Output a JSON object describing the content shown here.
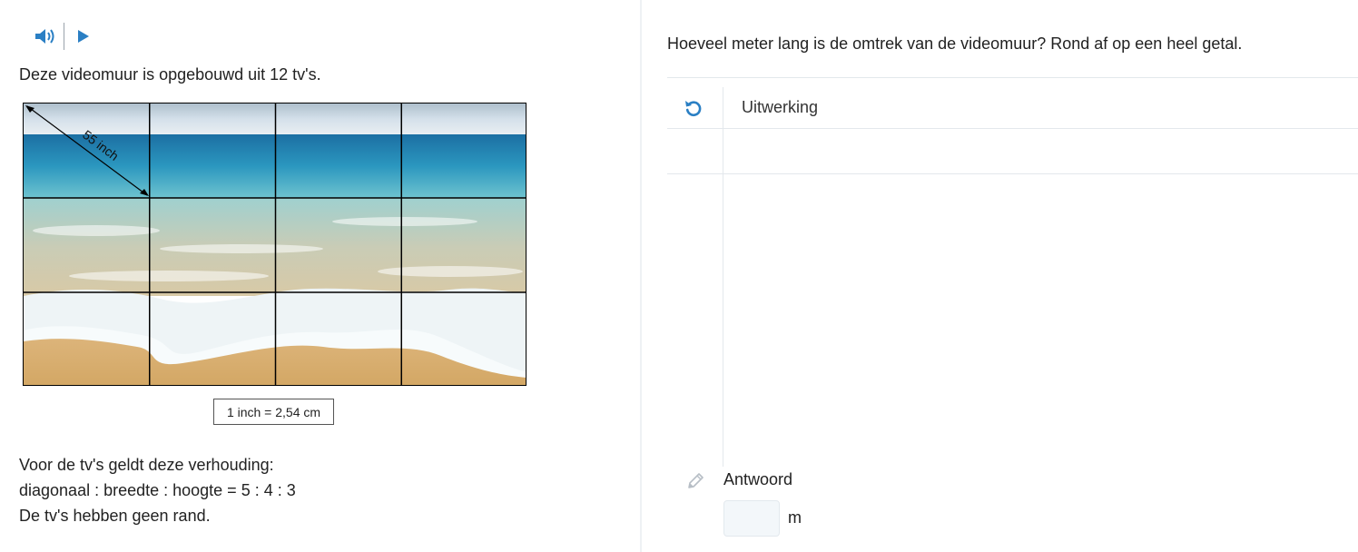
{
  "colors": {
    "accent": "#2a7fc4",
    "divider": "#eef1f4",
    "muted_icon": "#b7bec6"
  },
  "icons": {
    "speaker": "speaker-icon",
    "play": "play-icon",
    "reset": "reset-icon",
    "pencil": "pencil-icon"
  },
  "left": {
    "intro": "Deze videomuur is opgebouwd uit 12 tv's.",
    "image": {
      "diagonal_label": "55 inch",
      "rows": 3,
      "cols": 4
    },
    "conversion": "1 inch = 2,54 cm",
    "facts": [
      "Voor de tv's geldt deze verhouding:",
      "diagonaal : breedte : hoogte = 5 : 4 : 3",
      "De tv's hebben geen rand."
    ]
  },
  "right": {
    "question": "Hoeveel meter lang is de omtrek van de videomuur? Rond af op een heel getal.",
    "workout_label": "Uitwerking",
    "answer_label": "Antwoord",
    "answer_value": "",
    "answer_unit": "m"
  }
}
